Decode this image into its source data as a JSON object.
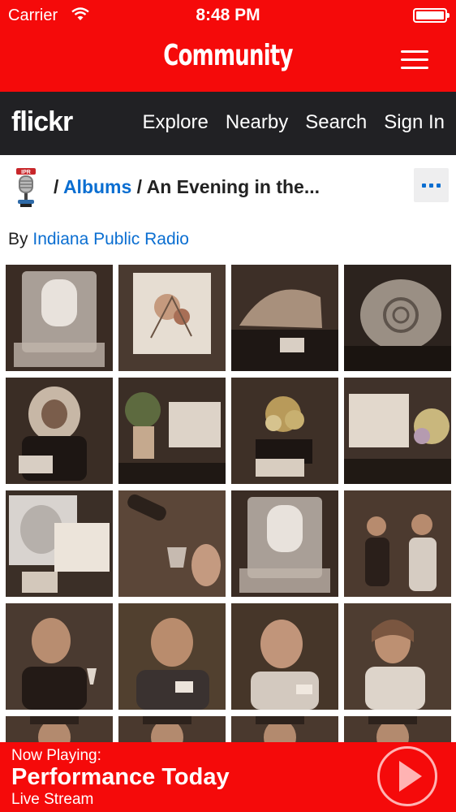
{
  "status_bar": {
    "carrier": "Carrier",
    "time": "8:48 PM"
  },
  "header": {
    "title": "Community",
    "menu_icon": "hamburger-icon"
  },
  "flickr_nav": {
    "logo": "flickr",
    "links": [
      "Explore",
      "Nearby",
      "Search",
      "Sign In"
    ]
  },
  "breadcrumb": {
    "separator": "/",
    "albums_label": "Albums",
    "album_title": "An Evening in the...",
    "more_icon": "ellipsis-icon"
  },
  "byline": {
    "prefix": "By",
    "author": "Indiana Public Radio"
  },
  "photos": [
    {
      "subject": "ice-sculpture-microphone"
    },
    {
      "subject": "floral-painting"
    },
    {
      "subject": "auction-display-table"
    },
    {
      "subject": "ceramic-spiral-plate"
    },
    {
      "subject": "geode-display"
    },
    {
      "subject": "potted-plant-display"
    },
    {
      "subject": "flower-arrangement"
    },
    {
      "subject": "flower-arrangement-sign"
    },
    {
      "subject": "portrait-drawing"
    },
    {
      "subject": "wine-pouring"
    },
    {
      "subject": "ice-sculpture-microphone"
    },
    {
      "subject": "guests-chatting"
    },
    {
      "subject": "man-with-wine-glass"
    },
    {
      "subject": "man-with-name-tag"
    },
    {
      "subject": "smiling-man"
    },
    {
      "subject": "woman-with-name-tag"
    },
    {
      "subject": "guest-partial"
    },
    {
      "subject": "guest-partial"
    },
    {
      "subject": "guest-partial"
    },
    {
      "subject": "guest-partial"
    }
  ],
  "now_playing": {
    "label": "Now Playing:",
    "title": "Performance Today",
    "subtitle": "Live Stream",
    "play_icon": "play-icon"
  },
  "colors": {
    "brand_red": "#f50a0a",
    "flickr_bar": "#212124",
    "link_blue": "#0a6ed1",
    "photo_tone": "#6b5444"
  }
}
